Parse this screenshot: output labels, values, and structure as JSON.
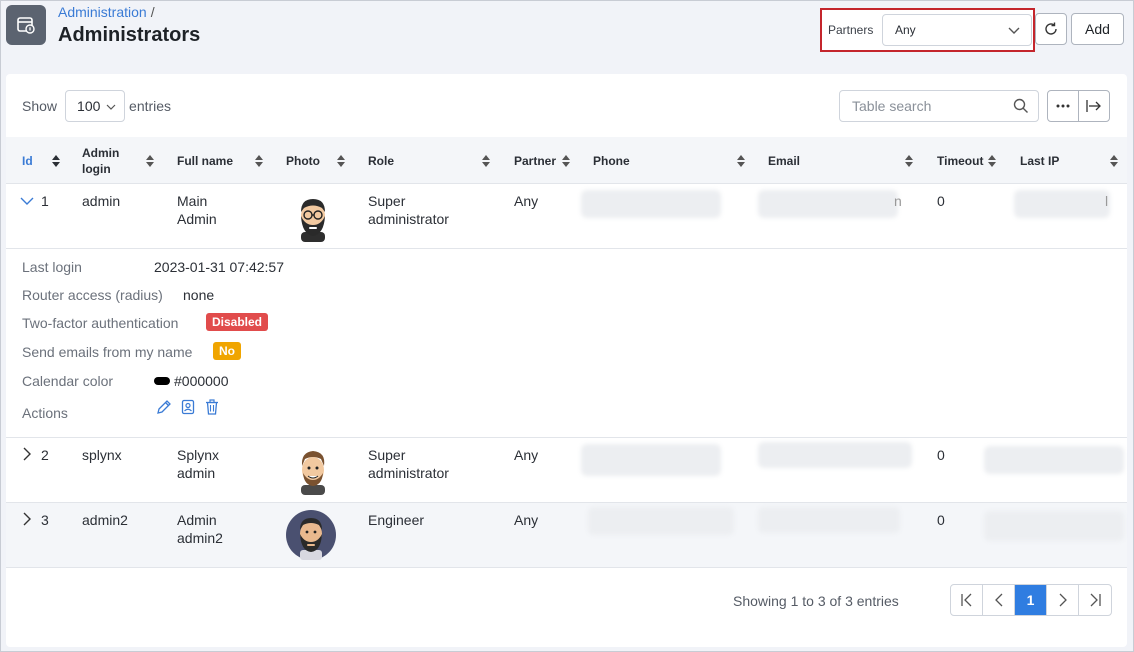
{
  "header": {
    "breadcrumb_parent": "Administration",
    "breadcrumb_sep": "/",
    "title": "Administrators"
  },
  "filters": {
    "partners_label": "Partners",
    "partners_value": "Any"
  },
  "toolbar": {
    "add_label": "Add"
  },
  "table_controls": {
    "show_label": "Show",
    "entries_value": "100",
    "entries_label": "entries",
    "search_placeholder": "Table search"
  },
  "columns": {
    "id": "Id",
    "admin_login_1": "Admin",
    "admin_login_2": "login",
    "full_name": "Full name",
    "photo": "Photo",
    "role": "Role",
    "partner": "Partner",
    "phone": "Phone",
    "email": "Email",
    "timeout": "Timeout",
    "last_ip": "Last IP"
  },
  "rows": [
    {
      "id": "1",
      "login": "admin",
      "name_1": "Main",
      "name_2": "Admin",
      "role_1": "Super",
      "role_2": "administrator",
      "partner": "Any",
      "timeout": "0",
      "email_tail": "n",
      "ip_tail": "l"
    },
    {
      "id": "2",
      "login": "splynx",
      "name_1": "Splynx",
      "name_2": "admin",
      "role_1": "Super",
      "role_2": "administrator",
      "partner": "Any",
      "timeout": "0"
    },
    {
      "id": "3",
      "login": "admin2",
      "name_1": "Admin",
      "name_2": "admin2",
      "role_1": "Engineer",
      "partner": "Any",
      "timeout": "0"
    }
  ],
  "detail": {
    "last_login_label": "Last login",
    "last_login_value": "2023-01-31 07:42:57",
    "router_label": "Router access (radius)",
    "router_value": "none",
    "twofa_label": "Two-factor authentication",
    "twofa_value": "Disabled",
    "send_emails_label": "Send emails from my name",
    "send_emails_value": "No",
    "calendar_label": "Calendar color",
    "calendar_value": "#000000",
    "actions_label": "Actions"
  },
  "colors": {
    "accent": "#3a7bd5",
    "badge_red": "#e14c4c",
    "badge_yellow": "#f0a500",
    "highlight_border": "#c4252c",
    "calendar_color": "#000000"
  },
  "footer": {
    "showing_text": "Showing 1 to 3 of 3 entries",
    "current_page": "1"
  }
}
